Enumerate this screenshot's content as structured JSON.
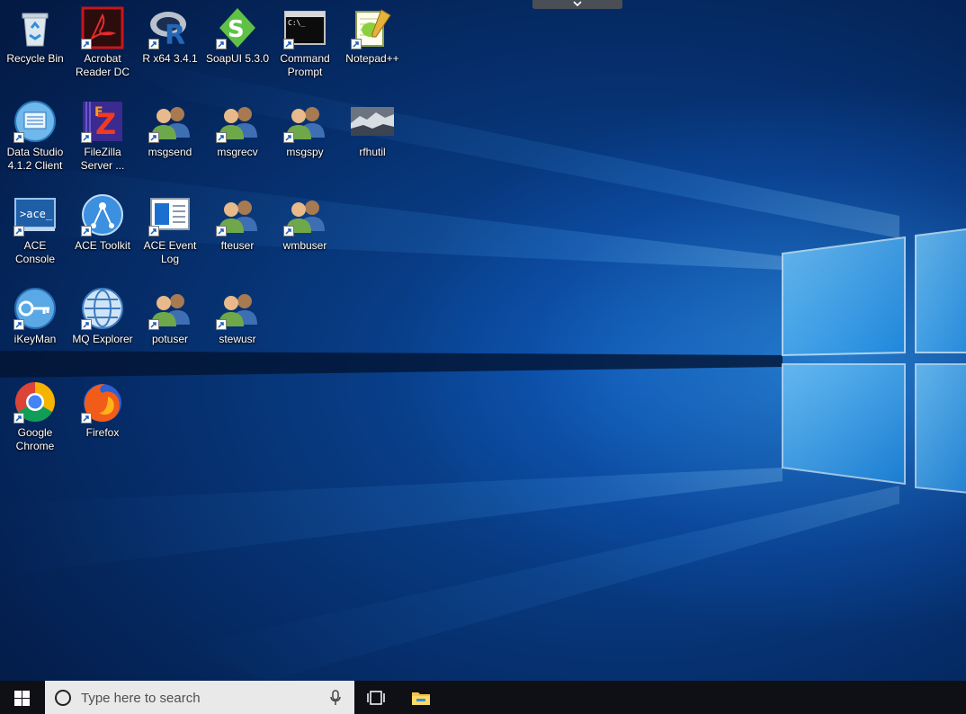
{
  "desktop": {
    "icons": [
      {
        "label": "Recycle Bin",
        "icon": "recycle-bin-icon"
      },
      {
        "label": "Acrobat Reader DC",
        "icon": "acrobat-reader-icon"
      },
      {
        "label": "R x64 3.4.1",
        "icon": "r-icon"
      },
      {
        "label": "SoapUI 5.3.0",
        "icon": "soapui-icon"
      },
      {
        "label": "Command Prompt",
        "icon": "command-prompt-icon"
      },
      {
        "label": "Notepad++",
        "icon": "notepad-plus-plus-icon"
      },
      {
        "label": "Data Studio 4.1.2 Client",
        "icon": "data-studio-icon"
      },
      {
        "label": "FileZilla Server ...",
        "icon": "filezilla-server-icon"
      },
      {
        "label": "msgsend",
        "icon": "users-icon"
      },
      {
        "label": "msgrecv",
        "icon": "users-icon"
      },
      {
        "label": "msgspy",
        "icon": "users-icon"
      },
      {
        "label": "rfhutil",
        "icon": "rfhutil-icon"
      },
      {
        "label": "ACE Console",
        "icon": "ace-console-icon"
      },
      {
        "label": "ACE Toolkit",
        "icon": "ace-toolkit-icon"
      },
      {
        "label": "ACE Event Log",
        "icon": "ace-event-log-icon"
      },
      {
        "label": "fteuser",
        "icon": "users-icon"
      },
      {
        "label": "wmbuser",
        "icon": "users-icon"
      },
      {
        "label": "iKeyMan",
        "icon": "ikeyman-icon"
      },
      {
        "label": "MQ Explorer",
        "icon": "mq-explorer-icon"
      },
      {
        "label": "potuser",
        "icon": "users-icon"
      },
      {
        "label": "stewusr",
        "icon": "users-icon"
      },
      {
        "label": "Google Chrome",
        "icon": "chrome-icon"
      },
      {
        "label": "Firefox",
        "icon": "firefox-icon"
      }
    ]
  },
  "taskbar": {
    "search_placeholder": "Type here to search",
    "icons": [
      "windows-start-icon",
      "search-circle-icon",
      "microphone-icon",
      "task-view-icon",
      "file-explorer-icon"
    ]
  },
  "colors": {
    "taskbar_bg": "#0f1016",
    "search_bg": "#e9e9e9",
    "desktop_blue": "#0b4fa6",
    "accent_light_blue": "#4fb8ff"
  }
}
